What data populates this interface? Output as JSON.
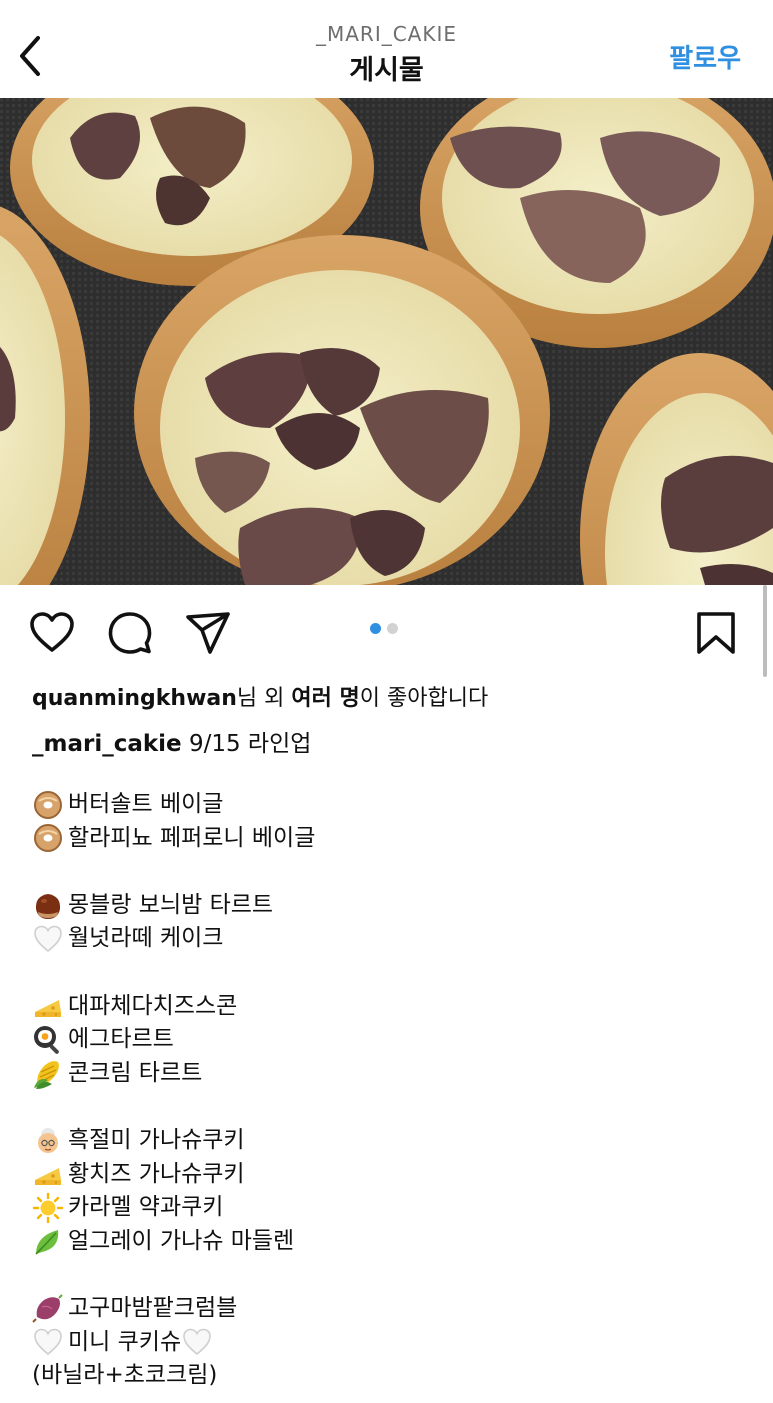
{
  "header": {
    "account": "_MARI_CAKIE",
    "title": "게시물",
    "follow_label": "팔로우"
  },
  "icons": {
    "back": "chevron-left-icon",
    "like": "heart-icon",
    "comment": "comment-bubble-icon",
    "share": "paper-plane-icon",
    "save": "bookmark-icon"
  },
  "carousel": {
    "current": 1,
    "total": 2
  },
  "likes": {
    "user": "quanmingkhwan",
    "mid": "님 외 ",
    "bold": "여러 명",
    "tail": "이 좋아합니다"
  },
  "caption": {
    "username": "_mari_cakie",
    "text": "9/15 라인업"
  },
  "menu": [
    {
      "emoji": "bagel-icon",
      "text": "버터솔트 베이글"
    },
    {
      "emoji": "bagel-icon",
      "text": "할라피뇨 페퍼로니 베이글"
    },
    {
      "blank": true
    },
    {
      "emoji": "chestnut-icon",
      "text": "몽블랑 보늬밤 타르트"
    },
    {
      "emoji": "white-heart-icon",
      "text": "월넛라떼 케이크"
    },
    {
      "blank": true
    },
    {
      "emoji": "cheese-icon",
      "text": "대파체다치즈스콘"
    },
    {
      "emoji": "frying-egg-icon",
      "text": "에그타르트"
    },
    {
      "emoji": "corn-icon",
      "text": "콘크림 타르트"
    },
    {
      "blank": true
    },
    {
      "emoji": "grandma-icon",
      "text": "흑절미 가나슈쿠키"
    },
    {
      "emoji": "cheese-icon",
      "text": "황치즈 가나슈쿠키"
    },
    {
      "emoji": "sun-icon",
      "text": "카라멜 약과쿠키"
    },
    {
      "emoji": "leaf-icon",
      "text": "얼그레이 가나슈 마들렌"
    },
    {
      "blank": true
    },
    {
      "emoji": "sweet-potato-icon",
      "text": "고구마밤팥크럼블"
    },
    {
      "emoji": "white-heart-icon",
      "text": "미니 쿠키슈",
      "trail": "white-heart-icon"
    },
    {
      "text": "(바닐라+초코크림)"
    }
  ],
  "colors": {
    "accent": "#2f8fe0",
    "muted": "#6e6e6e"
  }
}
